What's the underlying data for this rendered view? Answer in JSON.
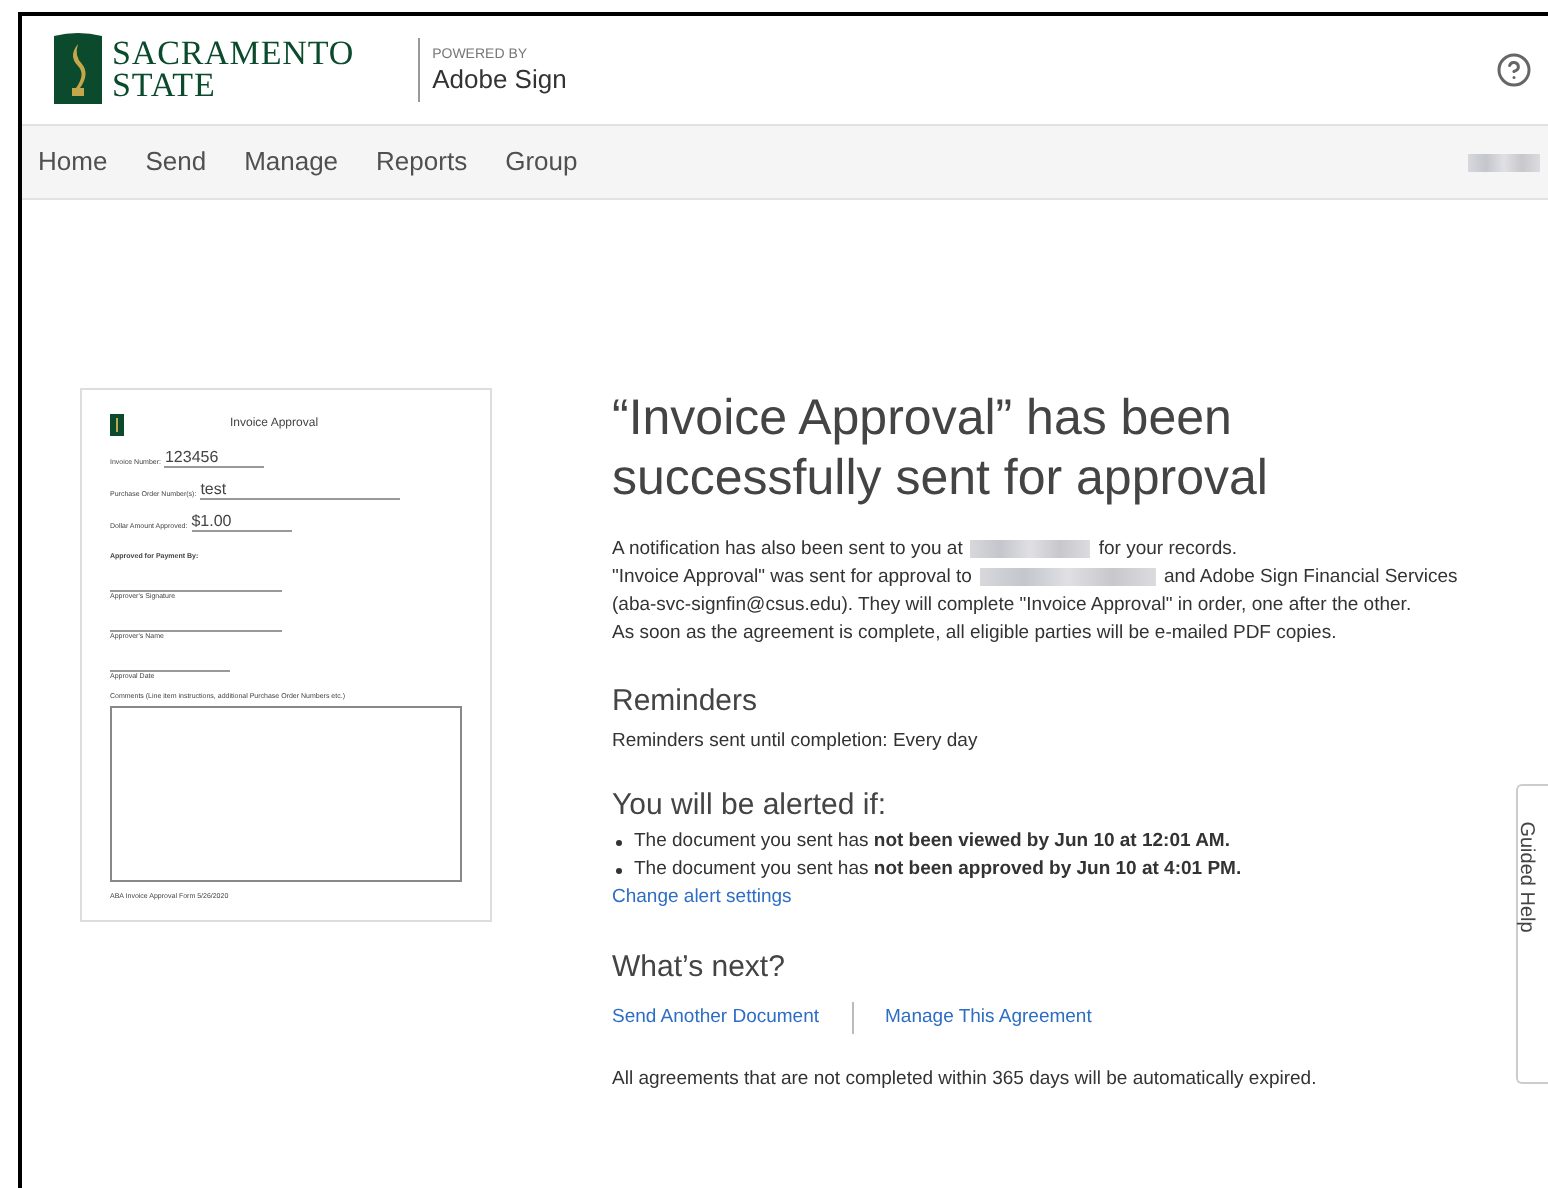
{
  "header": {
    "logo_line1": "SACRAMENTO",
    "logo_line2": "STATE",
    "powered_by": "POWERED BY",
    "product": "Adobe Sign"
  },
  "nav": {
    "items": [
      {
        "label": "Home"
      },
      {
        "label": "Send"
      },
      {
        "label": "Manage"
      },
      {
        "label": "Reports"
      },
      {
        "label": "Group"
      }
    ]
  },
  "preview": {
    "title": "Invoice Approval",
    "fields": [
      {
        "label": "Invoice Number:",
        "value": "123456"
      },
      {
        "label": "Purchase Order Number(s):",
        "value": "test"
      },
      {
        "label": "Dollar Amount Approved:",
        "value": "$1.00"
      }
    ],
    "approved_by": "Approved for Payment By:",
    "signature_lines": [
      "Approver's Signature",
      "Approver's Name",
      "Approval Date"
    ],
    "comments_label": "Comments (Line item instructions, additional Purchase Order Numbers etc.)",
    "footer": "ABA Invoice Approval Form 5/26/2020"
  },
  "main": {
    "title": "“Invoice Approval” has been successfully sent for approval",
    "notification": {
      "before": "A notification has also been sent to you at",
      "after": "for your records."
    },
    "sent_to": {
      "before": "\"Invoice Approval\" was sent for approval to",
      "after": "and Adobe Sign Financial Services",
      "continuation": "(aba-svc-signfin@csus.edu). They will complete \"Invoice Approval\" in order, one after the other."
    },
    "completion": "As soon as the agreement is complete, all eligible parties will be e-mailed PDF copies.",
    "reminders": {
      "heading": "Reminders",
      "text": "Reminders sent until completion: Every day"
    },
    "alerts": {
      "heading": "You will be alerted if:",
      "items": [
        "The document you sent has **not been viewed by Jun 10 at 12:01 AM.**",
        "The document you sent has **not been approved by Jun 10 at 4:01 PM.**"
      ],
      "link": "Change alert settings"
    },
    "next": {
      "heading": "What’s next?",
      "links": [
        "Send Another Document",
        "Manage This Agreement"
      ],
      "note": "All agreements that are not completed within 365 days will be automatically expired."
    }
  },
  "guided_help": {
    "label": "Guided Help"
  }
}
